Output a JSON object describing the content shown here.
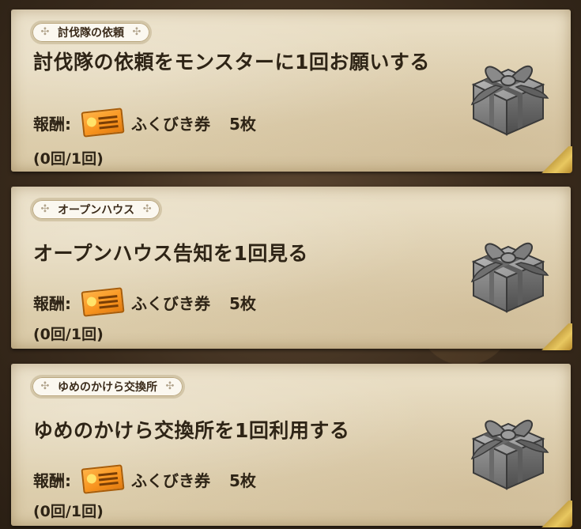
{
  "quests": [
    {
      "category": "討伐隊の依頼",
      "title": "討伐隊の依頼をモンスターに1回お願いする",
      "reward_label": "報酬:",
      "reward_item": "ふくびき券",
      "reward_count": "5枚",
      "progress": "(0回/1回)"
    },
    {
      "category": "オープンハウス",
      "title": "オープンハウス告知を1回見る",
      "reward_label": "報酬:",
      "reward_item": "ふくびき券",
      "reward_count": "5枚",
      "progress": "(0回/1回)"
    },
    {
      "category": "ゆめのかけら交換所",
      "title": "ゆめのかけら交換所を1回利用する",
      "reward_label": "報酬:",
      "reward_item": "ふくびき券",
      "reward_count": "5枚",
      "progress": "(0回/1回)"
    }
  ],
  "icons": {
    "ticket": "ticket-icon",
    "gift": "gift-box-icon"
  },
  "colors": {
    "card_bg": "#e3d6b8",
    "text": "#2e2416",
    "ticket": "#f7931e",
    "gift": "#7f7f7f"
  }
}
